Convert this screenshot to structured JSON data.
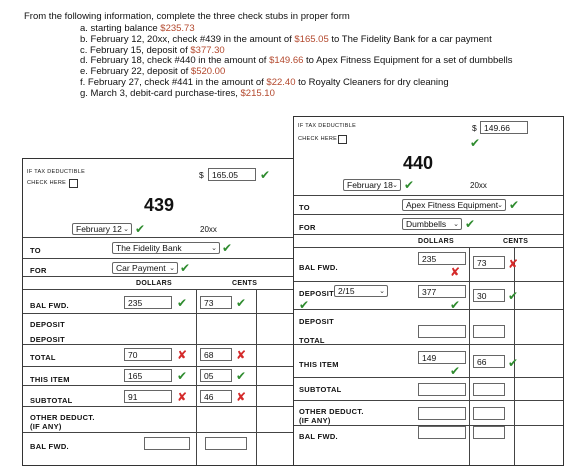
{
  "instructions": {
    "intro": "From the following information, complete the three check stubs in proper form",
    "items": [
      {
        "prefix": "a. starting balance ",
        "num": "$235.73",
        "suffix": ""
      },
      {
        "prefix": "b. February 12, 20xx, check #439 in the amount of ",
        "num": "$165.05",
        "suffix": " to The Fidelity Bank for a car payment"
      },
      {
        "prefix": "c. February 15, deposit of ",
        "num": "$377.30",
        "suffix": ""
      },
      {
        "prefix": "d. February 18, check #440 in the amount of ",
        "num": "$149.66",
        "suffix": " to Apex Fitness Equipment for a set of dumbbells"
      },
      {
        "prefix": "e. February 22, deposit of ",
        "num": "$520.00",
        "suffix": ""
      },
      {
        "prefix": "f. February 27, check #441 in the amount of ",
        "num": "$22.40",
        "suffix": " to Royalty Cleaners for dry cleaning"
      },
      {
        "prefix": "g. March 3, debit-card purchase-tires, ",
        "num": "$215.10",
        "suffix": ""
      }
    ]
  },
  "stub439": {
    "tax": "IF TAX DEDUCTIBLE",
    "check_here": "CHECK HERE",
    "amount": "165.05",
    "dollar_sign": "$",
    "number": "439",
    "date": "February 12",
    "year": "20xx",
    "to_label": "TO",
    "to_value": "The Fidelity Bank",
    "for_label": "FOR",
    "for_value": "Car Payment",
    "dollars": "DOLLARS",
    "cents": "CENTS",
    "bal_fwd": "BAL FWD.",
    "deposit1": "DEPOSIT",
    "deposit2": "DEPOSIT",
    "total": "TOTAL",
    "this_item": "THIS ITEM",
    "subtotal": "SUBTOTAL",
    "other_deduct": "OTHER DEDUCT.",
    "if_any": "(IF ANY)",
    "bal_fwd2": "BAL FWD.",
    "bal_dollars": "235",
    "bal_cents": "73",
    "total_dollars": "70",
    "total_cents": "68",
    "item_dollars": "165",
    "item_cents": "05",
    "sub_dollars": "91",
    "sub_cents": "46"
  },
  "stub440": {
    "tax": "IF TAX DEDUCTIBLE",
    "check_here": "CHECK HERE",
    "amount": "149.66",
    "dollar_sign": "$",
    "number": "440",
    "date": "February 18",
    "year": "20xx",
    "to_label": "TO",
    "to_value": "Apex Fitness Equipment",
    "for_label": "FOR",
    "for_value": "Dumbbells",
    "dollars": "DOLLARS",
    "cents": "CENTS",
    "bal_fwd": "BAL FWD.",
    "deposit_label": "DEPOSIT",
    "deposit_date": "2/15",
    "deposit2": "DEPOSIT",
    "total": "TOTAL",
    "this_item": "THIS ITEM",
    "subtotal": "SUBTOTAL",
    "other_deduct": "OTHER DEDUCT.",
    "if_any": "(IF ANY)",
    "bal_fwd2": "BAL FWD.",
    "bal_dollars": "235",
    "bal_cents": "73",
    "dep_dollars": "377",
    "dep_cents": "30",
    "item_dollars": "149",
    "item_cents": "66"
  },
  "icons": {
    "check": "✔",
    "cross": "✘",
    "chevron": "⌄"
  },
  "colors": {
    "correct": "#2e8b2e",
    "wrong": "#d42a2a",
    "given": "#b3482d"
  }
}
